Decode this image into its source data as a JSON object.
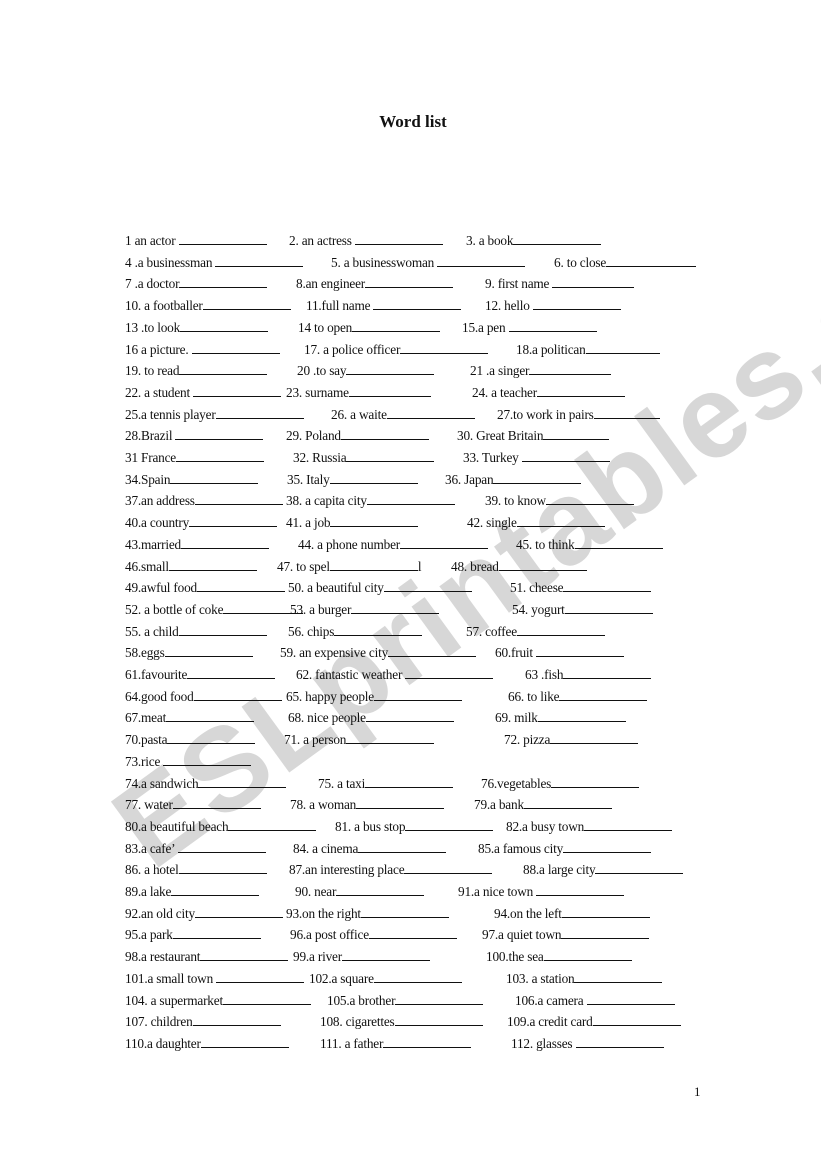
{
  "document": {
    "title": "Word list",
    "page_number": "1",
    "watermark": "ESLprintables.com",
    "rows": [
      [
        "1 an actor ",
        "2. an actress ",
        "3. a book"
      ],
      [
        "4 .a businessman ",
        "5. a businesswoman ",
        "6. to close"
      ],
      [
        "7 .a doctor",
        "8.an engineer",
        "9. first name "
      ],
      [
        "10.  a footballer",
        "11.full name ",
        "12. hello    "
      ],
      [
        "13 .to look",
        "14 to open",
        "15.a pen "
      ],
      [
        "16 a picture. ",
        "17. a police officer",
        "18.a politican"
      ],
      [
        "19. to read",
        "20 .to say",
        "21 .a singer"
      ],
      [
        "22. a student ",
        "23. surname",
        "24. a teacher"
      ],
      [
        "25.a tennis player",
        "26. a waite",
        "27.to work in pairs"
      ],
      [
        "28.Brazil ",
        "29. Poland",
        "30. Great Britain"
      ],
      [
        "31 France",
        "32. Russia",
        "33. Turkey "
      ],
      [
        "34.Spain",
        "35. Italy",
        "36. Japan"
      ],
      [
        "37.an address",
        "38. a capita city",
        "39. to know"
      ],
      [
        "40.a country",
        "41. a job",
        "42. single"
      ],
      [
        "43.married",
        "44. a phone number",
        "45. to think"
      ],
      [
        "46.small",
        "47. to spel",
        "48. bread"
      ],
      [
        "49.awful food",
        "50. a beautiful city",
        "51. cheese"
      ],
      [
        "52. a bottle of coke",
        "53. a burger",
        "54. yogurt"
      ],
      [
        "55. a child",
        "56. chips",
        "57. coffee"
      ],
      [
        "58.eggs",
        "59. an expensive city",
        "60.fruit "
      ],
      [
        "61.favourite",
        "62. fantastic weather ",
        "63 .fish"
      ],
      [
        "64.good food",
        "65. happy people",
        "66. to like"
      ],
      [
        "67.meat",
        "68. nice people",
        "69. milk"
      ],
      [
        "70.pasta",
        "71. a person",
        "72. pizza"
      ],
      [
        "73.rice "
      ],
      [
        "74.a sandwich",
        "75. a taxi",
        "76.vegetables"
      ],
      [
        "77. water",
        "78. a woman",
        "79.a bank"
      ],
      [
        "80.a beautiful beach",
        "81. a bus stop",
        "82.a busy town"
      ],
      [
        "83.a cafe’ ",
        "84. a cinema",
        "85.a famous city"
      ],
      [
        "86. a hotel",
        "87.an interesting place",
        "88.a large city"
      ],
      [
        "89.a lake",
        "90. near",
        "91.a nice town "
      ],
      [
        "92.an old city",
        "93.on the right",
        "94.on the left"
      ],
      [
        "95.a park",
        "96.a post office",
        "97.a quiet town"
      ],
      [
        "98.a restaurant",
        "99.a river",
        "100.the sea"
      ],
      [
        "101.a small town ",
        "102.a square",
        "103. a station"
      ],
      [
        "104. a supermarket",
        "105.a brother",
        "106.a camera "
      ],
      [
        "107. children",
        "108. cigarettes",
        "109.a credit card"
      ],
      [
        "110.a daughter",
        "111. a father",
        "112. glasses "
      ]
    ],
    "suffix_47": "l"
  }
}
